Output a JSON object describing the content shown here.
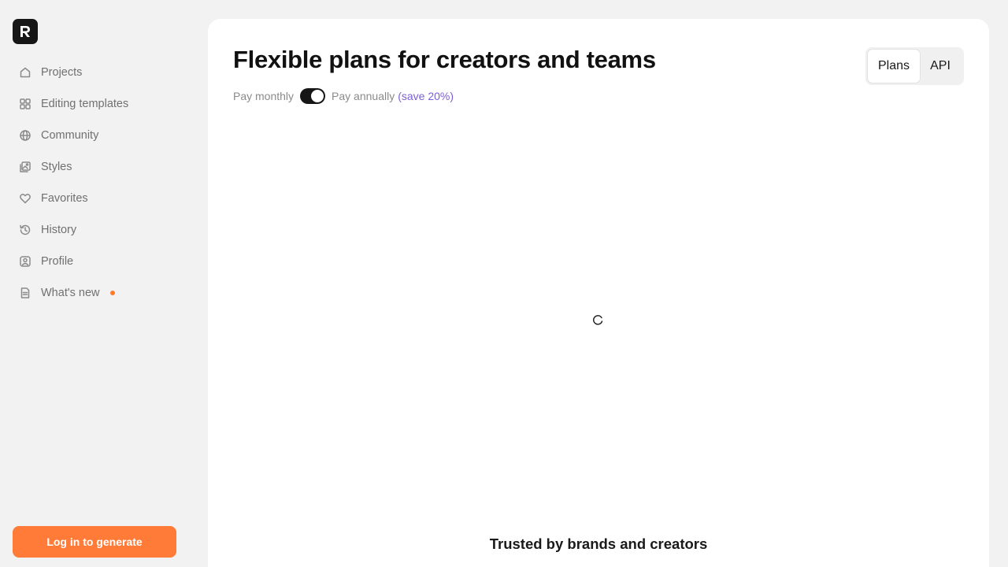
{
  "app": {
    "logo_icon": "app-logo-icon"
  },
  "sidebar": {
    "items": [
      {
        "label": "Projects",
        "icon": "home-icon"
      },
      {
        "label": "Editing templates",
        "icon": "grid-icon"
      },
      {
        "label": "Community",
        "icon": "globe-icon"
      },
      {
        "label": "Styles",
        "icon": "images-icon"
      },
      {
        "label": "Favorites",
        "icon": "heart-icon"
      },
      {
        "label": "History",
        "icon": "history-icon"
      },
      {
        "label": "Profile",
        "icon": "profile-icon"
      },
      {
        "label": "What's new",
        "icon": "document-icon"
      }
    ],
    "login_label": "Log in to generate",
    "accent": "#ff7b37"
  },
  "main": {
    "title": "Flexible plans for creators and teams",
    "billing": {
      "monthly_label": "Pay monthly",
      "annual_label": "Pay annually",
      "save_label": "(save 20%)",
      "annual_selected": true,
      "save_color": "#7b5fd6"
    },
    "segments": {
      "plans_label": "Plans",
      "api_label": "API",
      "selected": "Plans"
    },
    "trusted_label": "Trusted by brands and creators"
  }
}
